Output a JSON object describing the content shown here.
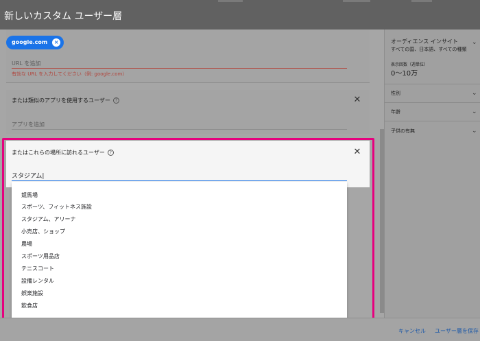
{
  "header": {
    "title": "新しいカスタム ユーザー層"
  },
  "url_card": {
    "chip_label": "google.com",
    "url_placeholder": "URL を追加",
    "url_error": "有効な URL を入力してください（例: google.com）"
  },
  "app_card": {
    "title": "または類似のアプリを使用するユーザー",
    "placeholder": "アプリを追加"
  },
  "location_card": {
    "title": "またはこれらの場所に訪れるユーザー",
    "input_value": "スタジアム|",
    "suggestions": [
      "競馬場",
      "スポーツ、フィットネス施設",
      "スタジアム、アリーナ",
      "小売店、ショップ",
      "農場",
      "スポーツ用品店",
      "テニスコート",
      "設備レンタル",
      "娯楽施設",
      "飲食店"
    ]
  },
  "insights": {
    "title": "オーディエンス インサイト",
    "subtitle": "すべての国、日本語、すべての種類",
    "impressions_label": "表示回数（週単位）",
    "impressions_value": "0〜10万",
    "sections": [
      "性別",
      "年齢",
      "子供の有無"
    ]
  },
  "footer": {
    "cancel_label": "キャンセル",
    "save_label": "ユーザー層を保存"
  },
  "icons": {
    "chip_close": "×",
    "close": "✕",
    "help": "?",
    "chevron": "⌄"
  },
  "colors": {
    "accent": "#1a73e8",
    "error": "#b1453c",
    "highlight": "#e6007e"
  }
}
